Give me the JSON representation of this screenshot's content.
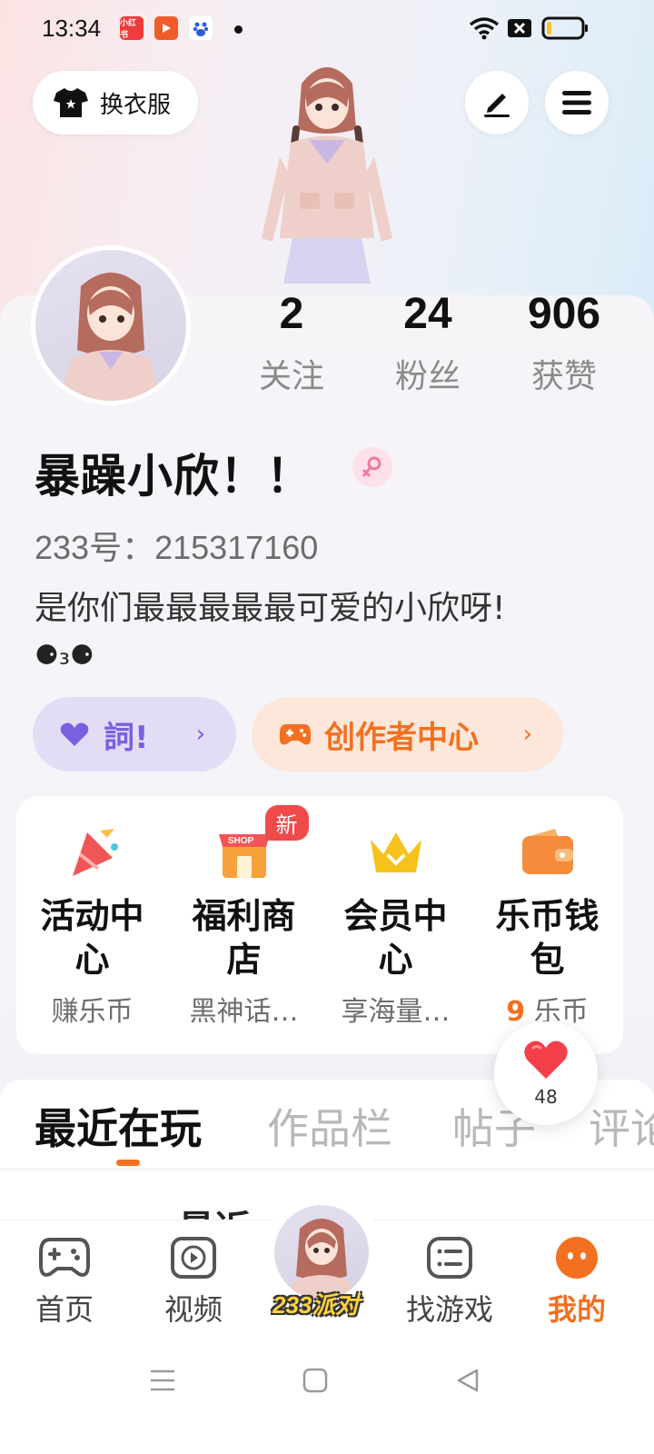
{
  "status_bar": {
    "time": "13:34"
  },
  "top_bar": {
    "outfit_label": "换衣服",
    "edit_icon": "pencil-icon",
    "menu_icon": "hamburger-icon"
  },
  "profile": {
    "stats": [
      {
        "value": "2",
        "label": "关注"
      },
      {
        "value": "24",
        "label": "粉丝"
      },
      {
        "value": "906",
        "label": "获赞"
      }
    ],
    "name": "暴躁小欣！！",
    "gender": "female",
    "id_text": "233号：215317160",
    "bio": "是你们最最最最最可爱的小欣呀!",
    "bio_emoji": "⚈₃⚈"
  },
  "pills": {
    "purple_label": "詞!",
    "creator_label": "创作者中心"
  },
  "quick_grid": [
    {
      "title": "活动中心",
      "sub": "赚乐币",
      "icon": "party-popper-icon"
    },
    {
      "title": "福利商店",
      "sub": "黑神话…",
      "icon": "shop-icon",
      "badge": "新"
    },
    {
      "title": "会员中心",
      "sub": "享海量…",
      "icon": "crown-icon"
    },
    {
      "title": "乐币钱包",
      "sub_number": "9",
      "sub_unit": "乐币",
      "icon": "wallet-icon"
    }
  ],
  "like_bubble": {
    "count": "48"
  },
  "tabs": [
    "最近在玩",
    "作品栏",
    "帖子",
    "评论"
  ],
  "peek_text": "最近",
  "bottom_nav": [
    {
      "label": "首页",
      "icon": "gamepad-icon"
    },
    {
      "label": "视频",
      "icon": "video-play-icon"
    },
    {
      "label": "233派对",
      "icon": "party-avatar"
    },
    {
      "label": "找游戏",
      "icon": "list-icon"
    },
    {
      "label": "我的",
      "icon": "me-face-icon"
    }
  ],
  "colors": {
    "accent": "#f2701f",
    "purple": "#7a5fe0",
    "badge_red": "#f04a4a"
  }
}
